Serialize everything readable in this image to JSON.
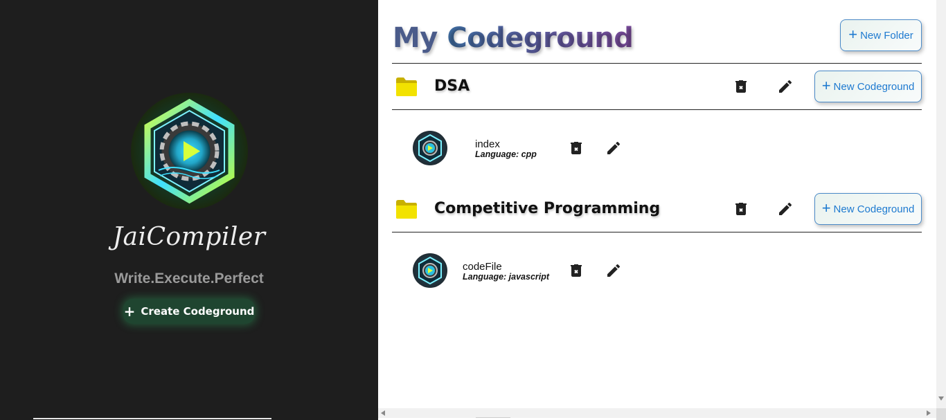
{
  "sidebar": {
    "brand": "JaiCompiler",
    "tagline": "Write.Execute.Perfect",
    "create_button": {
      "icon": "plus-icon",
      "label": "Create Codeground"
    }
  },
  "main": {
    "title_part1": "My",
    "title_part2": "Codeground",
    "new_folder_button": {
      "icon": "plus-icon",
      "label": "New Folder"
    },
    "folders": [
      {
        "name": "DSA",
        "new_codeground_label": "New Codeground",
        "files": [
          {
            "name": "index",
            "language_text": "Language: cpp"
          }
        ]
      },
      {
        "name": "Competitive Programming",
        "new_codeground_label": "New Codeground",
        "files": [
          {
            "name": "codeFile",
            "language_text": "Language: javascript"
          }
        ]
      }
    ]
  },
  "colors": {
    "sidebar_bg": "#1e1e1e",
    "accent_blue": "#1e7ad0",
    "create_button_bg": "#1f4530",
    "folder_yellow": "#e8d400"
  }
}
